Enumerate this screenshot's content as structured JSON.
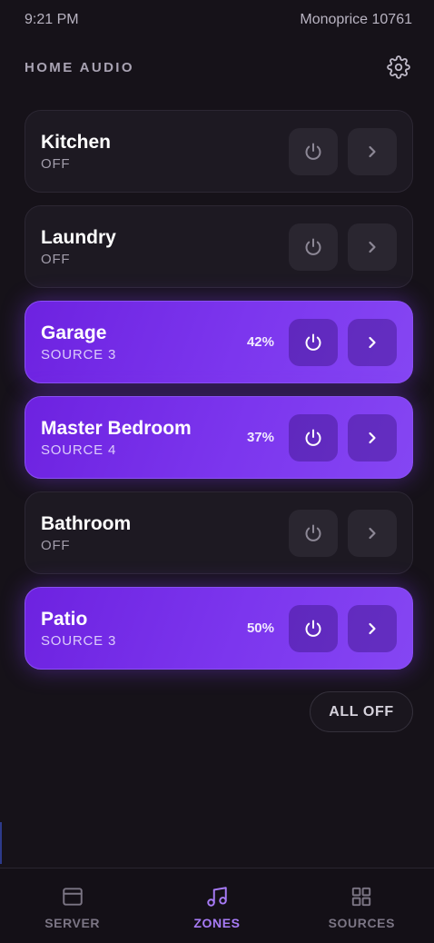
{
  "status_bar": {
    "time": "9:21 PM",
    "server_name": "Monoprice 10761"
  },
  "header": {
    "title": "HOME AUDIO",
    "settings_icon": "gear-icon"
  },
  "zones": [
    {
      "name": "Kitchen",
      "status": "OFF",
      "volume": "",
      "active": false
    },
    {
      "name": "Laundry",
      "status": "OFF",
      "volume": "",
      "active": false
    },
    {
      "name": "Garage",
      "status": "SOURCE 3",
      "volume": "42%",
      "active": true
    },
    {
      "name": "Master Bedroom",
      "status": "SOURCE 4",
      "volume": "37%",
      "active": true
    },
    {
      "name": "Bathroom",
      "status": "OFF",
      "volume": "",
      "active": false
    },
    {
      "name": "Patio",
      "status": "SOURCE 3",
      "volume": "50%",
      "active": true
    }
  ],
  "all_off_label": "ALL OFF",
  "nav": {
    "server": {
      "label": "SERVER",
      "icon": "window-icon"
    },
    "zones": {
      "label": "ZONES",
      "icon": "music-note-icon",
      "active": true
    },
    "sources": {
      "label": "SOURCES",
      "icon": "grid-icon"
    }
  },
  "colors": {
    "accent": "#7c36ee",
    "active_nav": "#a77bf6",
    "background": "#161219",
    "card": "#1d1922"
  }
}
